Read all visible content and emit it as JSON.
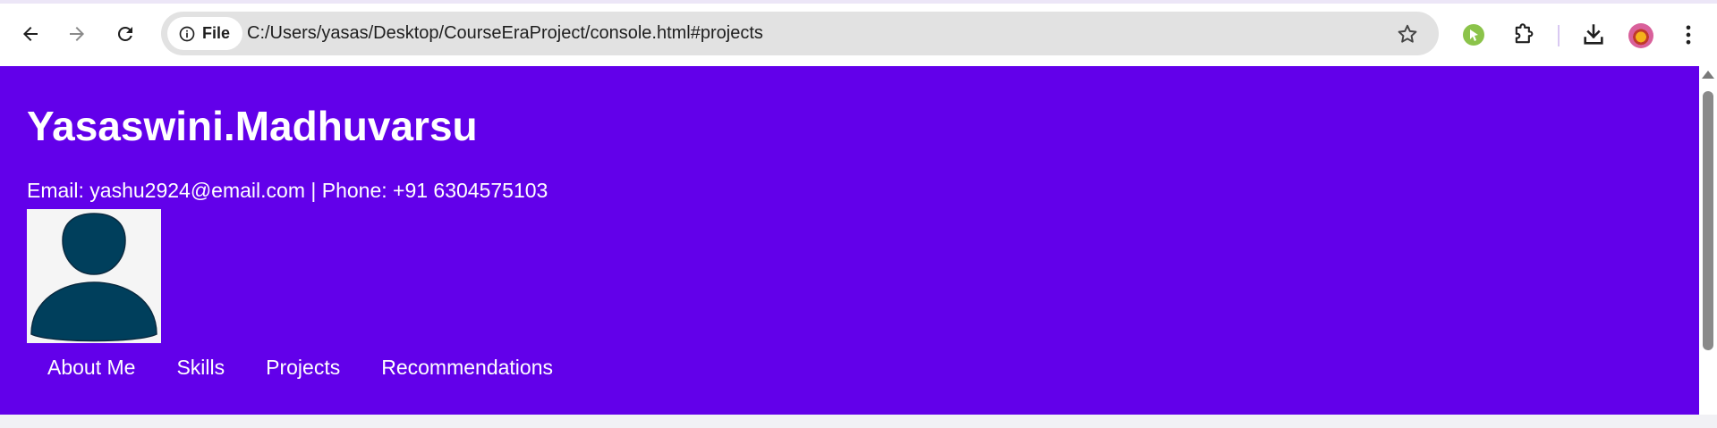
{
  "browser": {
    "site_chip_label": "File",
    "url": "C:/Users/yasas/Desktop/CourseEraProject/console.html#projects",
    "icons": {
      "back": "arrow-left-icon",
      "forward": "arrow-right-icon",
      "reload": "reload-icon",
      "info": "info-icon",
      "bookmark": "star-icon",
      "extension": "green-extension-icon",
      "extensions_menu": "puzzle-icon",
      "downloads": "download-icon",
      "menu": "kebab-menu-icon"
    }
  },
  "page": {
    "name": "Yasaswini.Madhuvarsu",
    "contact": "Email: yashu2924@email.com | Phone: +91 6304575103",
    "nav": [
      {
        "label": "About Me"
      },
      {
        "label": "Skills"
      },
      {
        "label": "Projects"
      },
      {
        "label": "Recommendations"
      }
    ]
  },
  "colors": {
    "header_bg": "#6200ea",
    "avatar_fill": "#003f5c",
    "page_bg": "#f1f1f5"
  }
}
